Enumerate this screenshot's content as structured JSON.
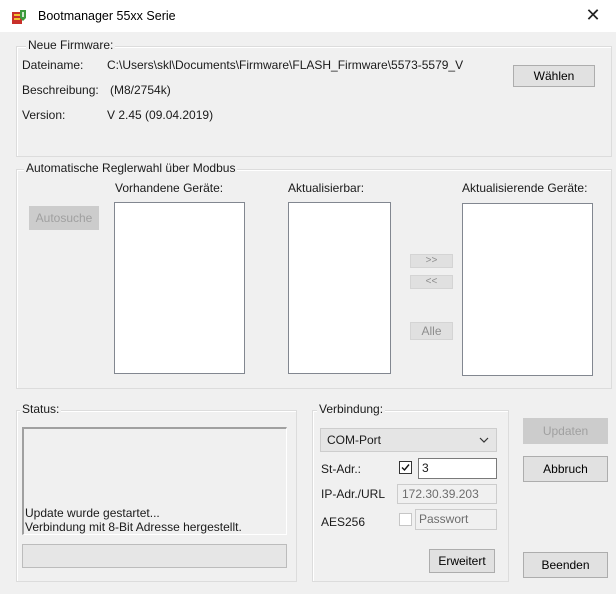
{
  "window": {
    "title": "Bootmanager 55xx Serie",
    "close_glyph": "✕"
  },
  "firmware": {
    "legend": "Neue Firmware:",
    "filename_label": "Dateiname:",
    "filename_value": "C:\\Users\\skl\\Documents\\Firmware\\FLASH_Firmware\\5573-5579_V",
    "choose_button": "Wählen",
    "description_label": "Beschreibung:",
    "description_value": "(M8/2754k)",
    "version_label": "Version:",
    "version_value": "V 2.45 (09.04.2019)"
  },
  "modbus": {
    "legend": "Automatische Reglerwahl über Modbus",
    "autosearch_button": "Autosuche",
    "available_label": "Vorhandene Geräte:",
    "updatable_label": "Aktualisierbar:",
    "updating_label": "Aktualisierende Geräte:",
    "move_right_button": ">>",
    "move_left_button": "<<",
    "all_button": "Alle"
  },
  "status": {
    "legend": "Status:",
    "lines": [
      "Update wurde gestartet...",
      "Verbindung mit 8-Bit Adresse hergestellt."
    ],
    "progress": 0
  },
  "connection": {
    "legend": "Verbindung:",
    "port_selected": "COM-Port",
    "st_addr_label": "St-Adr.:",
    "st_addr_checked": true,
    "st_addr_value": "3",
    "ip_label": "IP-Adr./URL",
    "ip_placeholder": "172.30.39.203",
    "aes_label": "AES256",
    "aes_checked": false,
    "password_placeholder": "Passwort",
    "advanced_button": "Erweitert"
  },
  "actions": {
    "update_button": "Updaten",
    "abort_button": "Abbruch",
    "exit_button": "Beenden"
  },
  "colors": {
    "window_bg": "#f0f0f0",
    "titlebar_bg": "#ffffff",
    "disabled_text": "#a0a0a0"
  }
}
